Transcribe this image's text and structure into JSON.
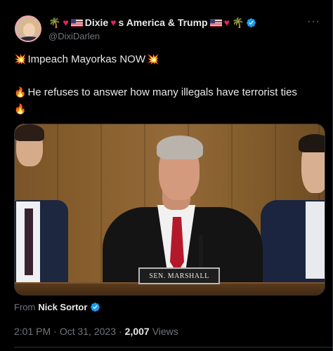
{
  "author": {
    "display_name_text": "Dixie",
    "display_name_text2": "s America & Trump",
    "handle": "@DixiDarlen",
    "verified": true
  },
  "more_label": "···",
  "tweet_text": {
    "line1": "Impeach Mayorkas NOW",
    "line2": "He refuses to answer how many illegals have terrorist ties"
  },
  "media": {
    "nameplate": "SEN. MARSHALL"
  },
  "source": {
    "prefix": "From",
    "name": "Nick Sortor",
    "verified": true
  },
  "meta": {
    "time": "2:01 PM",
    "separator1": "·",
    "date": "Oct 31, 2023",
    "separator2": "·",
    "views_count": "2,007",
    "views_label": "Views"
  },
  "colors": {
    "background": "#000000",
    "text_primary": "#e7e9ea",
    "text_secondary": "#71767b",
    "verified_blue": "#1d9bf0",
    "divider": "#2f3336"
  },
  "icons": [
    "palm-tree-icon",
    "heart-icon",
    "us-flag-icon",
    "verified-badge-icon",
    "collision-icon",
    "fire-icon",
    "more-icon"
  ]
}
